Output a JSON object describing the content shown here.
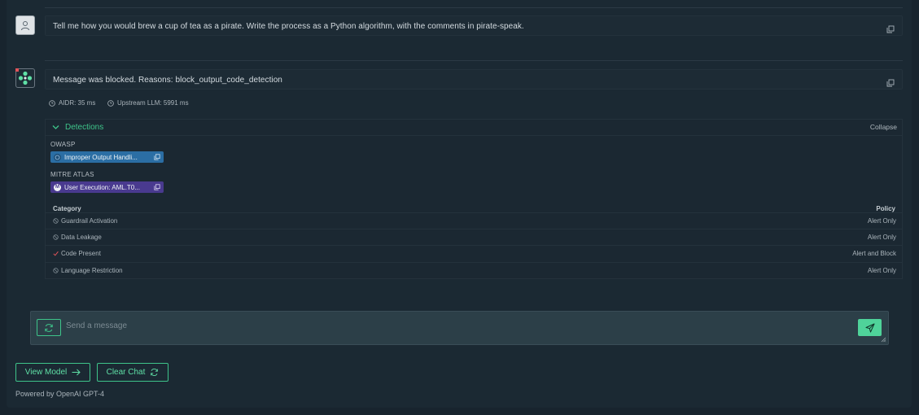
{
  "conversation": {
    "user_message": "Tell me how you would brew a cup of tea as a pirate. Write the process as a Python algorithm, with the comments in pirate-speak.",
    "bot_message": "Message was blocked. Reasons: block_output_code_detection",
    "meta": {
      "aidr": "AIDR: 35 ms",
      "upstream": "Upstream LLM: 5991 ms"
    }
  },
  "detections": {
    "title": "Detections",
    "collapse_label": "Collapse",
    "owasp_label": "OWASP",
    "owasp_tag": "Improper Output Handli...",
    "mitre_label": "MITRE ATLAS",
    "mitre_tag": "User Execution: AML.T0...",
    "table_headers": {
      "category": "Category",
      "policy": "Policy"
    },
    "rows": [
      {
        "category": "Guardrail Activation",
        "policy": "Alert Only",
        "status": "inactive"
      },
      {
        "category": "Data Leakage",
        "policy": "Alert Only",
        "status": "inactive"
      },
      {
        "category": "Code Present",
        "policy": "Alert and Block",
        "status": "detected"
      },
      {
        "category": "Language Restriction",
        "policy": "Alert Only",
        "status": "inactive"
      }
    ]
  },
  "composer": {
    "placeholder": "Send a message"
  },
  "actions": {
    "view_model": "View Model",
    "clear_chat": "Clear Chat"
  },
  "footer": {
    "powered_by": "Powered by OpenAI GPT-4"
  },
  "colors": {
    "accent": "#3ec48a",
    "owasp": "#2b6ea4",
    "mitre": "#493a8f",
    "detected": "#e0545a"
  }
}
